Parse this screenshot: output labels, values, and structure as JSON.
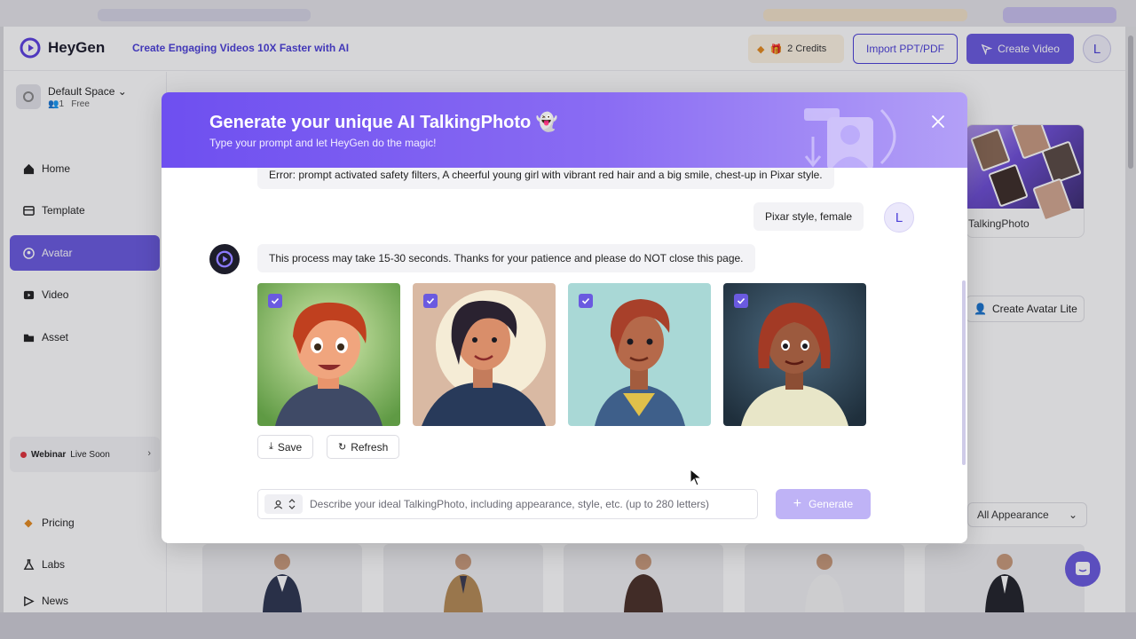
{
  "header": {
    "logo_text": "HeyGen",
    "tagline": "Create Engaging Videos 10X Faster with AI",
    "credits": "2 Credits",
    "import_label": "Import PPT/PDF",
    "create_video_label": "Create Video",
    "user_initial": "L"
  },
  "sidebar": {
    "space_name": "Default Space",
    "space_members": "1",
    "space_plan": "Free",
    "items": [
      {
        "label": "Home",
        "icon": "home-icon"
      },
      {
        "label": "Template",
        "icon": "template-icon"
      },
      {
        "label": "Avatar",
        "icon": "avatar-icon",
        "active": true
      },
      {
        "label": "Video",
        "icon": "video-icon"
      },
      {
        "label": "Asset",
        "icon": "asset-icon"
      }
    ],
    "webinar_title": "Webinar",
    "webinar_status": "Live Soon",
    "bottom_items": [
      {
        "label": "Pricing",
        "icon": "pricing-icon"
      },
      {
        "label": "Labs",
        "icon": "labs-icon"
      },
      {
        "label": "News",
        "icon": "news-icon"
      }
    ]
  },
  "background": {
    "talkingphoto_label": "TalkingPhoto",
    "create_avatar_lite_label": "Create Avatar Lite",
    "appearance_filter": "All Appearance"
  },
  "modal": {
    "title": "Generate your unique AI TalkingPhoto",
    "title_emoji": "👻",
    "subtitle": "Type your prompt and let HeyGen do the magic!",
    "messages": {
      "error": "Error: prompt activated safety filters, A cheerful young girl with vibrant red hair and a big smile, chest-up in Pixar style.",
      "user_prompt": "Pixar style, female",
      "bot_notice": "This process may take 15-30 seconds. Thanks for your patience and please do NOT close this page."
    },
    "user_initial": "L",
    "images": [
      {
        "selected": true,
        "bg": "#8fbf6a",
        "hair": "#c0401f",
        "skin": "#f0a57e",
        "shirt": "#3f4a66"
      },
      {
        "selected": true,
        "bg": "#d9b9a3",
        "hair": "#2a2230",
        "skin": "#d98e6a",
        "shirt": "#283a5a"
      },
      {
        "selected": true,
        "bg": "#a9d8d6",
        "hair": "#a8402a",
        "skin": "#b5694a",
        "shirt": "#3e5f8a"
      },
      {
        "selected": true,
        "bg": "#2f4658",
        "hair": "#a33a25",
        "skin": "#9c5a3e",
        "shirt": "#e8e6c8"
      }
    ],
    "save_label": "Save",
    "refresh_label": "Refresh",
    "prompt_placeholder": "Describe your ideal TalkingPhoto, including appearance, style, etc. (up to 280 letters)",
    "generate_label": "Generate"
  },
  "colors": {
    "brand": "#6a5ae0",
    "accent_text": "#4b3fd8",
    "header_gradient_start": "#6e4ff0",
    "header_gradient_end": "#b3a0f7"
  }
}
